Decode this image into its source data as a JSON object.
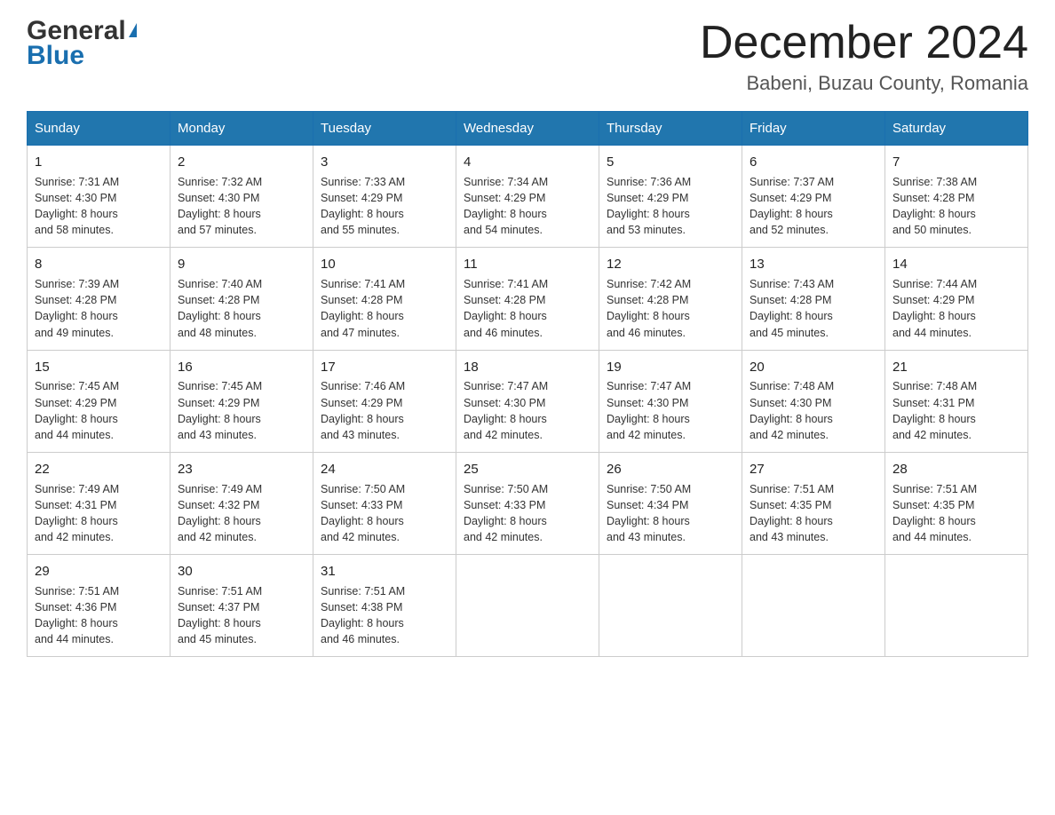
{
  "header": {
    "logo_general": "General",
    "logo_blue": "Blue",
    "month_year": "December 2024",
    "location": "Babeni, Buzau County, Romania"
  },
  "days_of_week": [
    "Sunday",
    "Monday",
    "Tuesday",
    "Wednesday",
    "Thursday",
    "Friday",
    "Saturday"
  ],
  "weeks": [
    [
      {
        "day": "1",
        "sunrise": "7:31 AM",
        "sunset": "4:30 PM",
        "daylight": "8 hours and 58 minutes."
      },
      {
        "day": "2",
        "sunrise": "7:32 AM",
        "sunset": "4:30 PM",
        "daylight": "8 hours and 57 minutes."
      },
      {
        "day": "3",
        "sunrise": "7:33 AM",
        "sunset": "4:29 PM",
        "daylight": "8 hours and 55 minutes."
      },
      {
        "day": "4",
        "sunrise": "7:34 AM",
        "sunset": "4:29 PM",
        "daylight": "8 hours and 54 minutes."
      },
      {
        "day": "5",
        "sunrise": "7:36 AM",
        "sunset": "4:29 PM",
        "daylight": "8 hours and 53 minutes."
      },
      {
        "day": "6",
        "sunrise": "7:37 AM",
        "sunset": "4:29 PM",
        "daylight": "8 hours and 52 minutes."
      },
      {
        "day": "7",
        "sunrise": "7:38 AM",
        "sunset": "4:28 PM",
        "daylight": "8 hours and 50 minutes."
      }
    ],
    [
      {
        "day": "8",
        "sunrise": "7:39 AM",
        "sunset": "4:28 PM",
        "daylight": "8 hours and 49 minutes."
      },
      {
        "day": "9",
        "sunrise": "7:40 AM",
        "sunset": "4:28 PM",
        "daylight": "8 hours and 48 minutes."
      },
      {
        "day": "10",
        "sunrise": "7:41 AM",
        "sunset": "4:28 PM",
        "daylight": "8 hours and 47 minutes."
      },
      {
        "day": "11",
        "sunrise": "7:41 AM",
        "sunset": "4:28 PM",
        "daylight": "8 hours and 46 minutes."
      },
      {
        "day": "12",
        "sunrise": "7:42 AM",
        "sunset": "4:28 PM",
        "daylight": "8 hours and 46 minutes."
      },
      {
        "day": "13",
        "sunrise": "7:43 AM",
        "sunset": "4:28 PM",
        "daylight": "8 hours and 45 minutes."
      },
      {
        "day": "14",
        "sunrise": "7:44 AM",
        "sunset": "4:29 PM",
        "daylight": "8 hours and 44 minutes."
      }
    ],
    [
      {
        "day": "15",
        "sunrise": "7:45 AM",
        "sunset": "4:29 PM",
        "daylight": "8 hours and 44 minutes."
      },
      {
        "day": "16",
        "sunrise": "7:45 AM",
        "sunset": "4:29 PM",
        "daylight": "8 hours and 43 minutes."
      },
      {
        "day": "17",
        "sunrise": "7:46 AM",
        "sunset": "4:29 PM",
        "daylight": "8 hours and 43 minutes."
      },
      {
        "day": "18",
        "sunrise": "7:47 AM",
        "sunset": "4:30 PM",
        "daylight": "8 hours and 42 minutes."
      },
      {
        "day": "19",
        "sunrise": "7:47 AM",
        "sunset": "4:30 PM",
        "daylight": "8 hours and 42 minutes."
      },
      {
        "day": "20",
        "sunrise": "7:48 AM",
        "sunset": "4:30 PM",
        "daylight": "8 hours and 42 minutes."
      },
      {
        "day": "21",
        "sunrise": "7:48 AM",
        "sunset": "4:31 PM",
        "daylight": "8 hours and 42 minutes."
      }
    ],
    [
      {
        "day": "22",
        "sunrise": "7:49 AM",
        "sunset": "4:31 PM",
        "daylight": "8 hours and 42 minutes."
      },
      {
        "day": "23",
        "sunrise": "7:49 AM",
        "sunset": "4:32 PM",
        "daylight": "8 hours and 42 minutes."
      },
      {
        "day": "24",
        "sunrise": "7:50 AM",
        "sunset": "4:33 PM",
        "daylight": "8 hours and 42 minutes."
      },
      {
        "day": "25",
        "sunrise": "7:50 AM",
        "sunset": "4:33 PM",
        "daylight": "8 hours and 42 minutes."
      },
      {
        "day": "26",
        "sunrise": "7:50 AM",
        "sunset": "4:34 PM",
        "daylight": "8 hours and 43 minutes."
      },
      {
        "day": "27",
        "sunrise": "7:51 AM",
        "sunset": "4:35 PM",
        "daylight": "8 hours and 43 minutes."
      },
      {
        "day": "28",
        "sunrise": "7:51 AM",
        "sunset": "4:35 PM",
        "daylight": "8 hours and 44 minutes."
      }
    ],
    [
      {
        "day": "29",
        "sunrise": "7:51 AM",
        "sunset": "4:36 PM",
        "daylight": "8 hours and 44 minutes."
      },
      {
        "day": "30",
        "sunrise": "7:51 AM",
        "sunset": "4:37 PM",
        "daylight": "8 hours and 45 minutes."
      },
      {
        "day": "31",
        "sunrise": "7:51 AM",
        "sunset": "4:38 PM",
        "daylight": "8 hours and 46 minutes."
      },
      null,
      null,
      null,
      null
    ]
  ],
  "labels": {
    "sunrise": "Sunrise:",
    "sunset": "Sunset:",
    "daylight": "Daylight:"
  },
  "colors": {
    "header_bg": "#2176ae",
    "accent_blue": "#1a6faf"
  }
}
